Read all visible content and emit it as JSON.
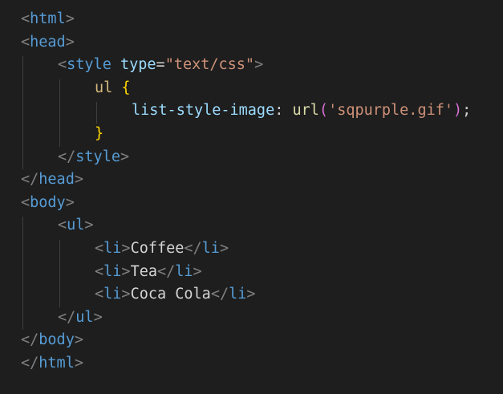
{
  "editor": {
    "language": "html",
    "theme_background": "#1e1e1e",
    "lines": [
      {
        "indent": 0,
        "tokens": [
          {
            "k": "bracket",
            "t": "<"
          },
          {
            "k": "tag",
            "t": "html"
          },
          {
            "k": "bracket",
            "t": ">"
          }
        ]
      },
      {
        "indent": 0,
        "tokens": [
          {
            "k": "bracket",
            "t": "<"
          },
          {
            "k": "tag",
            "t": "head"
          },
          {
            "k": "bracket",
            "t": ">"
          }
        ]
      },
      {
        "indent": 1,
        "tokens": [
          {
            "k": "bracket",
            "t": "<"
          },
          {
            "k": "tag",
            "t": "style"
          },
          {
            "k": "text",
            "t": " "
          },
          {
            "k": "attr",
            "t": "type"
          },
          {
            "k": "punc",
            "t": "="
          },
          {
            "k": "str",
            "t": "\"text/css\""
          },
          {
            "k": "bracket",
            "t": ">"
          }
        ]
      },
      {
        "indent": 2,
        "tokens": [
          {
            "k": "sel",
            "t": "ul"
          },
          {
            "k": "text",
            "t": " "
          },
          {
            "k": "brace",
            "t": "{"
          }
        ]
      },
      {
        "indent": 3,
        "tokens": [
          {
            "k": "prop",
            "t": "list-style-image"
          },
          {
            "k": "punc",
            "t": ": "
          },
          {
            "k": "func",
            "t": "url"
          },
          {
            "k": "paren",
            "t": "("
          },
          {
            "k": "str",
            "t": "'sqpurple.gif'"
          },
          {
            "k": "paren",
            "t": ")"
          },
          {
            "k": "punc",
            "t": ";"
          }
        ]
      },
      {
        "indent": 2,
        "tokens": [
          {
            "k": "brace",
            "t": "}"
          }
        ]
      },
      {
        "indent": 1,
        "tokens": [
          {
            "k": "bracket",
            "t": "</"
          },
          {
            "k": "tag",
            "t": "style"
          },
          {
            "k": "bracket",
            "t": ">"
          }
        ]
      },
      {
        "indent": 0,
        "tokens": [
          {
            "k": "bracket",
            "t": "</"
          },
          {
            "k": "tag",
            "t": "head"
          },
          {
            "k": "bracket",
            "t": ">"
          }
        ]
      },
      {
        "indent": 0,
        "tokens": [
          {
            "k": "bracket",
            "t": "<"
          },
          {
            "k": "tag",
            "t": "body"
          },
          {
            "k": "bracket",
            "t": ">"
          }
        ]
      },
      {
        "indent": 1,
        "tokens": [
          {
            "k": "bracket",
            "t": "<"
          },
          {
            "k": "tag",
            "t": "ul"
          },
          {
            "k": "bracket",
            "t": ">"
          }
        ]
      },
      {
        "indent": 2,
        "tokens": [
          {
            "k": "bracket",
            "t": "<"
          },
          {
            "k": "tag",
            "t": "li"
          },
          {
            "k": "bracket",
            "t": ">"
          },
          {
            "k": "text",
            "t": "Coffee"
          },
          {
            "k": "bracket",
            "t": "</"
          },
          {
            "k": "tag",
            "t": "li"
          },
          {
            "k": "bracket",
            "t": ">"
          }
        ]
      },
      {
        "indent": 2,
        "tokens": [
          {
            "k": "bracket",
            "t": "<"
          },
          {
            "k": "tag",
            "t": "li"
          },
          {
            "k": "bracket",
            "t": ">"
          },
          {
            "k": "text",
            "t": "Tea"
          },
          {
            "k": "bracket",
            "t": "</"
          },
          {
            "k": "tag",
            "t": "li"
          },
          {
            "k": "bracket",
            "t": ">"
          }
        ]
      },
      {
        "indent": 2,
        "tokens": [
          {
            "k": "bracket",
            "t": "<"
          },
          {
            "k": "tag",
            "t": "li"
          },
          {
            "k": "bracket",
            "t": ">"
          },
          {
            "k": "text",
            "t": "Coca Cola"
          },
          {
            "k": "bracket",
            "t": "</"
          },
          {
            "k": "tag",
            "t": "li"
          },
          {
            "k": "bracket",
            "t": ">"
          }
        ]
      },
      {
        "indent": 1,
        "tokens": [
          {
            "k": "bracket",
            "t": "</"
          },
          {
            "k": "tag",
            "t": "ul"
          },
          {
            "k": "bracket",
            "t": ">"
          }
        ]
      },
      {
        "indent": 0,
        "tokens": [
          {
            "k": "bracket",
            "t": "</"
          },
          {
            "k": "tag",
            "t": "body"
          },
          {
            "k": "bracket",
            "t": ">"
          }
        ]
      },
      {
        "indent": 0,
        "tokens": [
          {
            "k": "bracket",
            "t": "</"
          },
          {
            "k": "tag",
            "t": "html"
          },
          {
            "k": "bracket",
            "t": ">"
          }
        ]
      }
    ]
  }
}
